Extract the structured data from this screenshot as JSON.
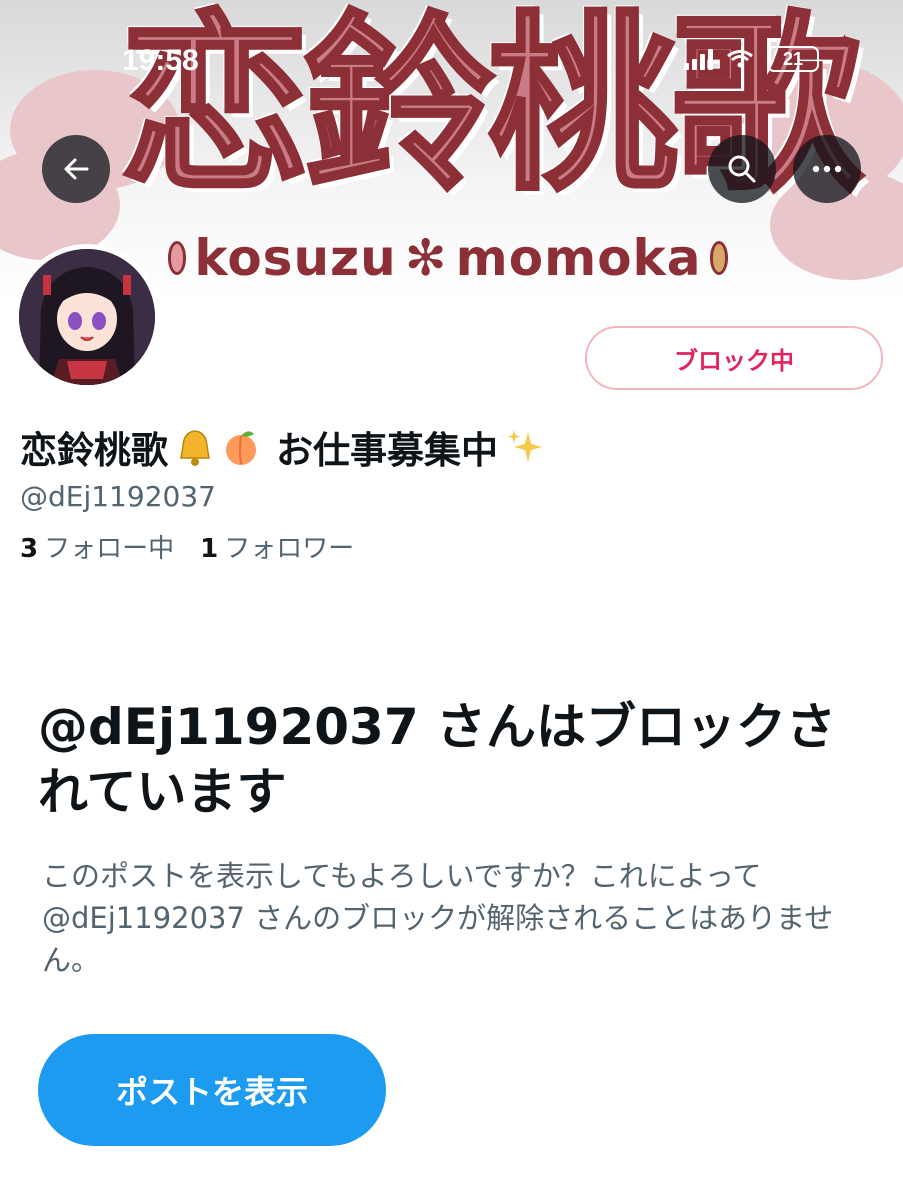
{
  "status_bar": {
    "time": "19:58",
    "battery": "21"
  },
  "banner": {
    "logo_text": "恋鈴桃歌",
    "logo_sub_left": "kosuzu",
    "logo_sub_right": "momoka"
  },
  "profile": {
    "block_button_label": "ブロック中",
    "display_name": "恋鈴桃歌",
    "display_name_suffix": "お仕事募集中",
    "name_emojis": [
      "bell-emoji",
      "peach-emoji",
      "sparkles-emoji"
    ],
    "handle": "@dEj1192037",
    "following_count": "3",
    "following_label": "フォロー中",
    "followers_count": "1",
    "followers_label": "フォロワー"
  },
  "blocked_notice": {
    "title": "@dEj1192037 さんはブロックされています",
    "description": "このポストを表示してもよろしいですか？これによって @dEj1192037 さんのブロックが解除されることはありません。",
    "view_button_label": "ポストを表示"
  },
  "colors": {
    "accent": "#1d9bf0",
    "block_red": "#e0245e",
    "secondary_text": "#536471",
    "banner_brand": "#8c2f36"
  }
}
